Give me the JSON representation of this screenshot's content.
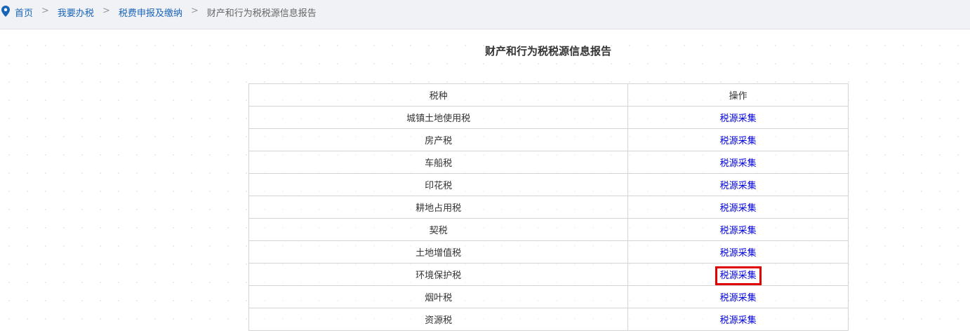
{
  "breadcrumb": {
    "items": [
      "首页",
      "我要办税",
      "税费申报及缴纳"
    ],
    "separator": ">",
    "current": "财产和行为税税源信息报告"
  },
  "page": {
    "title": "财产和行为税税源信息报告"
  },
  "table": {
    "headers": {
      "tax_type": "税种",
      "operation": "操作"
    },
    "rows": [
      {
        "tax": "城镇土地使用税",
        "action": "税源采集"
      },
      {
        "tax": "房产税",
        "action": "税源采集"
      },
      {
        "tax": "车船税",
        "action": "税源采集"
      },
      {
        "tax": "印花税",
        "action": "税源采集"
      },
      {
        "tax": "耕地占用税",
        "action": "税源采集"
      },
      {
        "tax": "契税",
        "action": "税源采集"
      },
      {
        "tax": "土地增值税",
        "action": "税源采集"
      },
      {
        "tax": "环境保护税",
        "action": "税源采集",
        "highlighted": true
      },
      {
        "tax": "烟叶税",
        "action": "税源采集"
      },
      {
        "tax": "资源税",
        "action": "税源采集"
      }
    ]
  },
  "colors": {
    "link": "#1a64b8",
    "action_link": "#0000dd",
    "highlight": "#e00000"
  },
  "icons": {
    "breadcrumb": "location-pin-icon"
  }
}
